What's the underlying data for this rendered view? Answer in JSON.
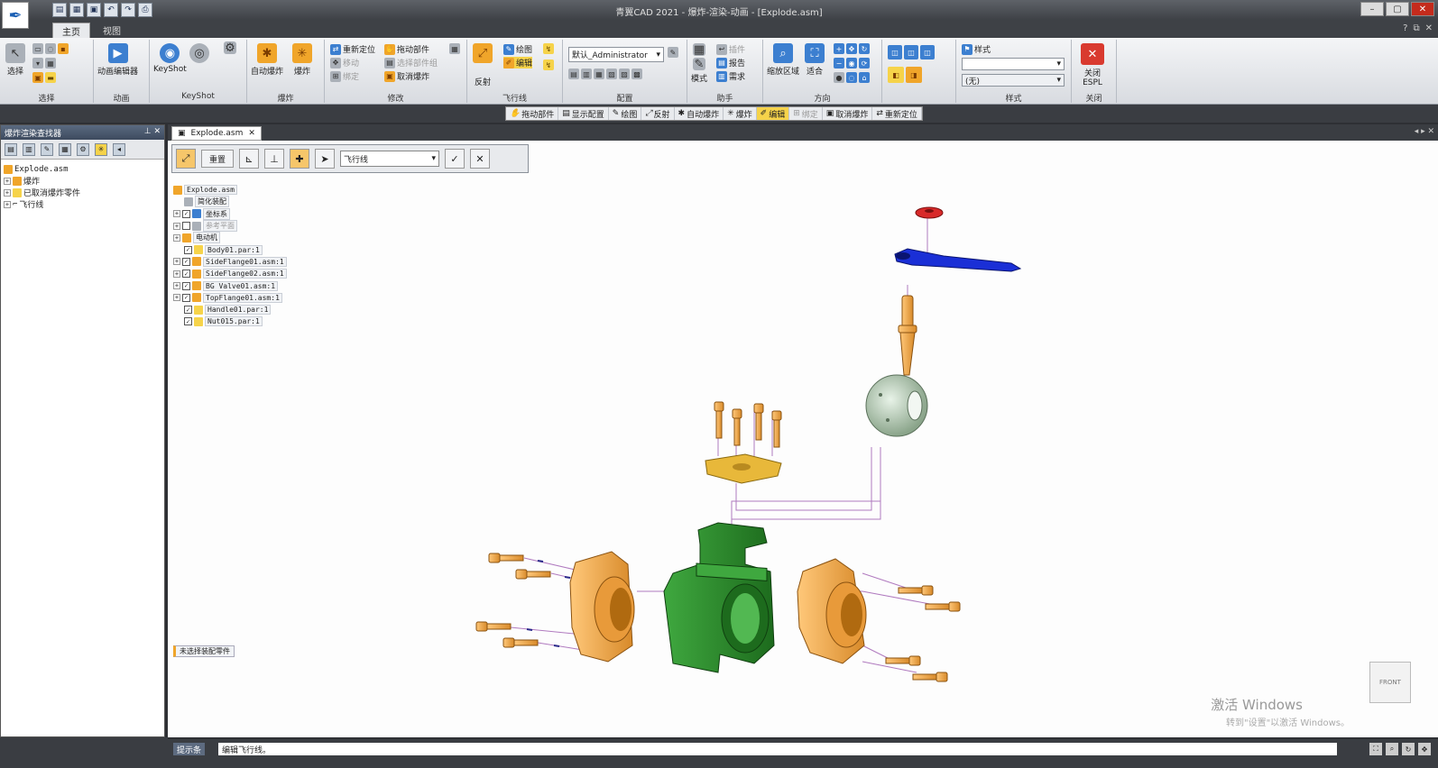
{
  "app": {
    "title": "青翼CAD 2021 - 爆炸-渲染-动画 - [Explode.asm]",
    "logo_icon": "feather-icon"
  },
  "ribbon_tabs": [
    "主页",
    "视图"
  ],
  "ribbon": {
    "select": {
      "label": "选择",
      "group": "选择"
    },
    "animation": {
      "label": "动画编辑器",
      "group": "动画"
    },
    "keyshot": {
      "label": "KeyShot",
      "group": "KeyShot"
    },
    "explode": {
      "auto": "自动爆炸",
      "explode": "爆炸",
      "group": "爆炸"
    },
    "modify": {
      "reposition": "重新定位",
      "drag": "拖动部件",
      "unexplode": "取消爆炸",
      "dim1": "移动",
      "dim2": "绑定",
      "dim3": "选择部件组",
      "group": "修改"
    },
    "flowline": {
      "view": "绘图",
      "edit": "编辑",
      "reflect": "反射",
      "group": "飞行线"
    },
    "config": {
      "user": "默认_Administrator",
      "group": "配置"
    },
    "display": {
      "mode": "模式",
      "report": "报告",
      "need": "需求",
      "dim": "插件",
      "group": "助手"
    },
    "direction": {
      "zoomarea": "缩放区域",
      "fit": "适合",
      "group": "方向"
    },
    "style": {
      "label": "样式",
      "value": "(无)",
      "group": "样式"
    },
    "close": {
      "label": "关闭 ESPL",
      "group": "关闭"
    }
  },
  "cmdstrip": [
    "拖动部件",
    "显示配置",
    "绘图",
    "反射",
    "自动爆炸",
    "爆炸",
    "编辑",
    "绑定",
    "取消爆炸",
    "重新定位"
  ],
  "left_panel": {
    "title": "爆炸渲染查找器",
    "tree": [
      {
        "label": "Explode.asm",
        "level": 0
      },
      {
        "label": "爆炸",
        "level": 1
      },
      {
        "label": "已取消爆炸零件",
        "level": 1
      },
      {
        "label": "飞行线",
        "level": 1
      }
    ]
  },
  "doc_tab": {
    "label": "Explode.asm"
  },
  "path_toolbar": {
    "reset": "重置",
    "dropdown": "飞行线"
  },
  "viewport_tree": [
    {
      "label": "Explode.asm",
      "checked": null,
      "expander": false
    },
    {
      "label": "简化装配",
      "checked": null,
      "expander": false
    },
    {
      "label": "坐标系",
      "checked": true,
      "expander": true
    },
    {
      "label": "参考平面",
      "checked": false,
      "expander": true,
      "dim": true
    },
    {
      "label": "电动机",
      "checked": null,
      "expander": true
    },
    {
      "label": "Body01.par:1",
      "checked": true,
      "expander": false
    },
    {
      "label": "SideFlange01.asm:1",
      "checked": true,
      "expander": true
    },
    {
      "label": "SideFlange02.asm:1",
      "checked": true,
      "expander": true
    },
    {
      "label": "BG Valve01.asm:1",
      "checked": true,
      "expander": true
    },
    {
      "label": "TopFlange01.asm:1",
      "checked": true,
      "expander": true
    },
    {
      "label": "Handle01.par:1",
      "checked": true,
      "expander": false
    },
    {
      "label": "Nut015.par:1",
      "checked": true,
      "expander": false
    }
  ],
  "filter_button": "未选择装配零件",
  "view_cube": "FRONT",
  "watermark": {
    "line1": "激活 Windows",
    "line2": "转到\"设置\"以激活 Windows。"
  },
  "status": {
    "label": "提示条",
    "prompt": "编辑飞行线。"
  },
  "colors": {
    "body": "#2e8b2e",
    "flange": "#f0a84a",
    "handle": "#1a2fd6",
    "nut": "#d82a2a",
    "ball": "#b9cdb9",
    "flowline": "#b07abf"
  }
}
